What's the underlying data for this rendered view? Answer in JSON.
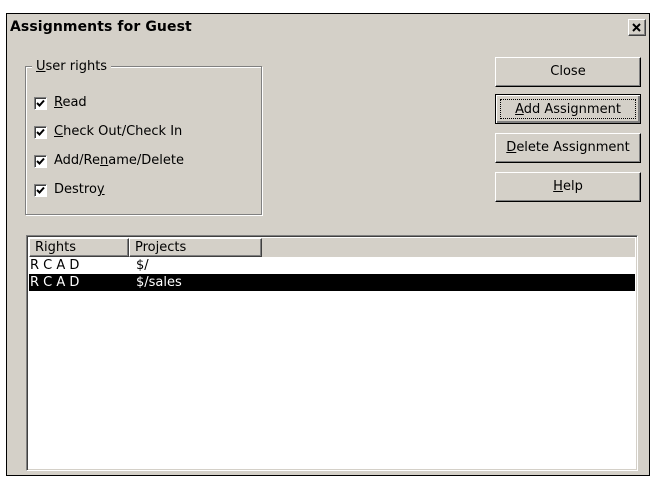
{
  "window": {
    "title": "Assignments for Guest"
  },
  "user_rights": {
    "legend_prefix": "",
    "legend_access": "U",
    "legend_rest": "ser rights",
    "items": [
      {
        "pre": "",
        "key": "R",
        "post": "ead",
        "checked": true
      },
      {
        "pre": "",
        "key": "C",
        "post": "heck Out/Check In",
        "checked": true
      },
      {
        "pre": "Add/Re",
        "key": "n",
        "post": "ame/Delete",
        "checked": true
      },
      {
        "pre": "Destro",
        "key": "y",
        "post": "",
        "checked": true
      }
    ]
  },
  "buttons": {
    "close": {
      "pre": "Close",
      "key": "",
      "post": ""
    },
    "add_assignment": {
      "pre": "",
      "key": "A",
      "post": "dd Assignment"
    },
    "delete_assignment": {
      "pre": "",
      "key": "D",
      "post": "elete Assignment"
    },
    "help": {
      "pre": "",
      "key": "H",
      "post": "elp"
    }
  },
  "assignments": {
    "columns": [
      "Rights",
      "Projects"
    ],
    "rows": [
      {
        "rights": "R C A D",
        "project": "$/",
        "selected": false
      },
      {
        "rights": "R C A D",
        "project": "$/sales",
        "selected": true
      }
    ]
  }
}
